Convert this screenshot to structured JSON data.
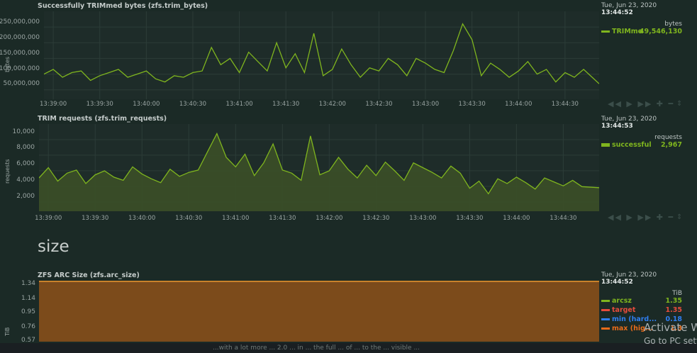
{
  "charts": [
    {
      "title": "Successfully TRIMmed bytes (zfs.trim_bytes)",
      "yunit": "bytes",
      "yticks": [
        "250,000,000",
        "200,000,000",
        "150,000,000",
        "100,000,000",
        "50,000,000"
      ],
      "xticks": [
        "13:39:00",
        "13:39:30",
        "13:40:00",
        "13:40:30",
        "13:41:00",
        "13:41:30",
        "13:42:00",
        "13:42:30",
        "13:43:00",
        "13:43:30",
        "13:44:00",
        "13:44:30"
      ],
      "legend": {
        "date": "Tue, Jun 23, 2020",
        "time": "13:44:52",
        "unit": "bytes",
        "series": [
          {
            "name": "TRIMme",
            "value": "49,546,130",
            "color": "#7fb51e"
          }
        ]
      }
    },
    {
      "title": "TRIM requests (zfs.trim_requests)",
      "yunit": "requests",
      "yticks": [
        "10,000",
        "8,000",
        "6,000",
        "4,000",
        "2,000"
      ],
      "xticks": [
        "13:39:00",
        "13:39:30",
        "13:40:00",
        "13:40:30",
        "13:41:00",
        "13:41:30",
        "13:42:00",
        "13:42:30",
        "13:43:00",
        "13:43:30",
        "13:44:00",
        "13:44:30"
      ],
      "legend": {
        "date": "Tue, Jun 23, 2020",
        "time": "13:44:53",
        "unit": "requests",
        "series": [
          {
            "name": "successful",
            "value": "2,967",
            "color": "#7fb51e"
          }
        ]
      }
    },
    {
      "title": "ZFS ARC Size (zfs.arc_size)",
      "yunit": "TiB",
      "yticks": [
        "1.34",
        "1.14",
        "0.95",
        "0.76",
        "0.57"
      ],
      "legend": {
        "date": "Tue, Jun 23, 2020",
        "time": "13:44:52",
        "unit": "TiB",
        "series": [
          {
            "name": "arcsz",
            "value": "1.35",
            "color": "#7fb51e"
          },
          {
            "name": "target",
            "value": "1.35",
            "color": "#e74c3c"
          },
          {
            "name": "min (hard...",
            "value": "0.18",
            "color": "#2f7ef0"
          },
          {
            "name": "max (hig...",
            "value": "1.3",
            "color": "#e86b1a"
          }
        ]
      }
    }
  ],
  "section_heading": "size",
  "controls": "◀◀ ▶ ▶▶ ✚ ━",
  "resize_icon": "⇕",
  "footer_fragment": "...with a lot more ... 2.0 ... in ... the full ... of ... to the ... visible ...",
  "watermark": {
    "line1": "Activate W",
    "line2": "Go to PC sett"
  },
  "chart_data": [
    {
      "type": "line",
      "title": "Successfully TRIMmed bytes (zfs.trim_bytes)",
      "ylabel": "bytes",
      "ylim": [
        0,
        280000000
      ],
      "xlim": [
        "13:38:54",
        "13:44:52"
      ],
      "grid": true,
      "legend": "right",
      "x": [
        "13:38:54",
        "13:39:00",
        "13:39:06",
        "13:39:12",
        "13:39:18",
        "13:39:24",
        "13:39:30",
        "13:39:36",
        "13:39:42",
        "13:39:48",
        "13:39:54",
        "13:40:00",
        "13:40:06",
        "13:40:12",
        "13:40:18",
        "13:40:24",
        "13:40:30",
        "13:40:36",
        "13:40:42",
        "13:40:48",
        "13:40:54",
        "13:41:00",
        "13:41:06",
        "13:41:12",
        "13:41:18",
        "13:41:24",
        "13:41:30",
        "13:41:36",
        "13:41:42",
        "13:41:48",
        "13:41:54",
        "13:42:00",
        "13:42:06",
        "13:42:12",
        "13:42:18",
        "13:42:24",
        "13:42:30",
        "13:42:36",
        "13:42:42",
        "13:42:48",
        "13:42:54",
        "13:43:00",
        "13:43:06",
        "13:43:12",
        "13:43:18",
        "13:43:24",
        "13:43:30",
        "13:43:36",
        "13:43:42",
        "13:43:48",
        "13:43:54",
        "13:44:00",
        "13:44:06",
        "13:44:12",
        "13:44:18",
        "13:44:24",
        "13:44:30",
        "13:44:36",
        "13:44:42",
        "13:44:52"
      ],
      "series": [
        {
          "name": "TRIMme",
          "color": "#7fb51e",
          "values": [
            80000000,
            95000000,
            70000000,
            85000000,
            90000000,
            60000000,
            75000000,
            85000000,
            95000000,
            70000000,
            80000000,
            90000000,
            65000000,
            55000000,
            75000000,
            70000000,
            85000000,
            90000000,
            165000000,
            110000000,
            130000000,
            85000000,
            150000000,
            120000000,
            90000000,
            180000000,
            100000000,
            145000000,
            85000000,
            210000000,
            75000000,
            95000000,
            160000000,
            110000000,
            70000000,
            100000000,
            90000000,
            130000000,
            110000000,
            75000000,
            130000000,
            115000000,
            95000000,
            85000000,
            155000000,
            240000000,
            190000000,
            75000000,
            115000000,
            95000000,
            70000000,
            90000000,
            120000000,
            80000000,
            95000000,
            55000000,
            85000000,
            70000000,
            95000000,
            49546130
          ]
        }
      ]
    },
    {
      "type": "area",
      "title": "TRIM requests (zfs.trim_requests)",
      "ylabel": "requests",
      "ylim": [
        0,
        11000
      ],
      "xlim": [
        "13:38:54",
        "13:44:53"
      ],
      "grid": true,
      "legend": "right",
      "x": [
        "13:38:54",
        "13:39:00",
        "13:39:06",
        "13:39:12",
        "13:39:18",
        "13:39:24",
        "13:39:30",
        "13:39:36",
        "13:39:42",
        "13:39:48",
        "13:39:54",
        "13:40:00",
        "13:40:06",
        "13:40:12",
        "13:40:18",
        "13:40:24",
        "13:40:30",
        "13:40:36",
        "13:40:42",
        "13:40:48",
        "13:40:54",
        "13:41:00",
        "13:41:06",
        "13:41:12",
        "13:41:18",
        "13:41:24",
        "13:41:30",
        "13:41:36",
        "13:41:42",
        "13:41:48",
        "13:41:54",
        "13:42:00",
        "13:42:06",
        "13:42:12",
        "13:42:18",
        "13:42:24",
        "13:42:30",
        "13:42:36",
        "13:42:42",
        "13:42:48",
        "13:42:54",
        "13:43:00",
        "13:43:06",
        "13:43:12",
        "13:43:18",
        "13:43:24",
        "13:43:30",
        "13:43:36",
        "13:43:42",
        "13:43:48",
        "13:43:54",
        "13:44:00",
        "13:44:06",
        "13:44:12",
        "13:44:18",
        "13:44:24",
        "13:44:30",
        "13:44:36",
        "13:44:42",
        "13:44:53"
      ],
      "series": [
        {
          "name": "successful",
          "color": "#7fb51e",
          "values": [
            4200,
            5500,
            3800,
            4800,
            5200,
            3500,
            4600,
            5100,
            4300,
            3900,
            5600,
            4700,
            4100,
            3600,
            5300,
            4400,
            4900,
            5200,
            7500,
            9800,
            6800,
            5600,
            7200,
            4500,
            6100,
            8500,
            5200,
            4800,
            3900,
            9500,
            4600,
            5100,
            6800,
            5300,
            4200,
            5800,
            4500,
            6200,
            5100,
            3900,
            6100,
            5500,
            4900,
            4200,
            5700,
            4800,
            2900,
            3800,
            2200,
            4100,
            3500,
            4300,
            3600,
            2800,
            4200,
            3700,
            3200,
            3900,
            3100,
            2967
          ]
        }
      ]
    },
    {
      "type": "area",
      "title": "ZFS ARC Size (zfs.arc_size)",
      "ylabel": "TiB",
      "ylim": [
        0.57,
        1.35
      ],
      "grid": true,
      "legend": "right",
      "series": [
        {
          "name": "arcsz",
          "color": "#7fb51e",
          "values": [
            1.35
          ]
        },
        {
          "name": "target",
          "color": "#e74c3c",
          "values": [
            1.35
          ]
        },
        {
          "name": "min (hard...",
          "color": "#2f7ef0",
          "values": [
            0.18
          ]
        },
        {
          "name": "max (hig...",
          "color": "#e86b1a",
          "values": [
            1.3
          ]
        }
      ]
    }
  ]
}
